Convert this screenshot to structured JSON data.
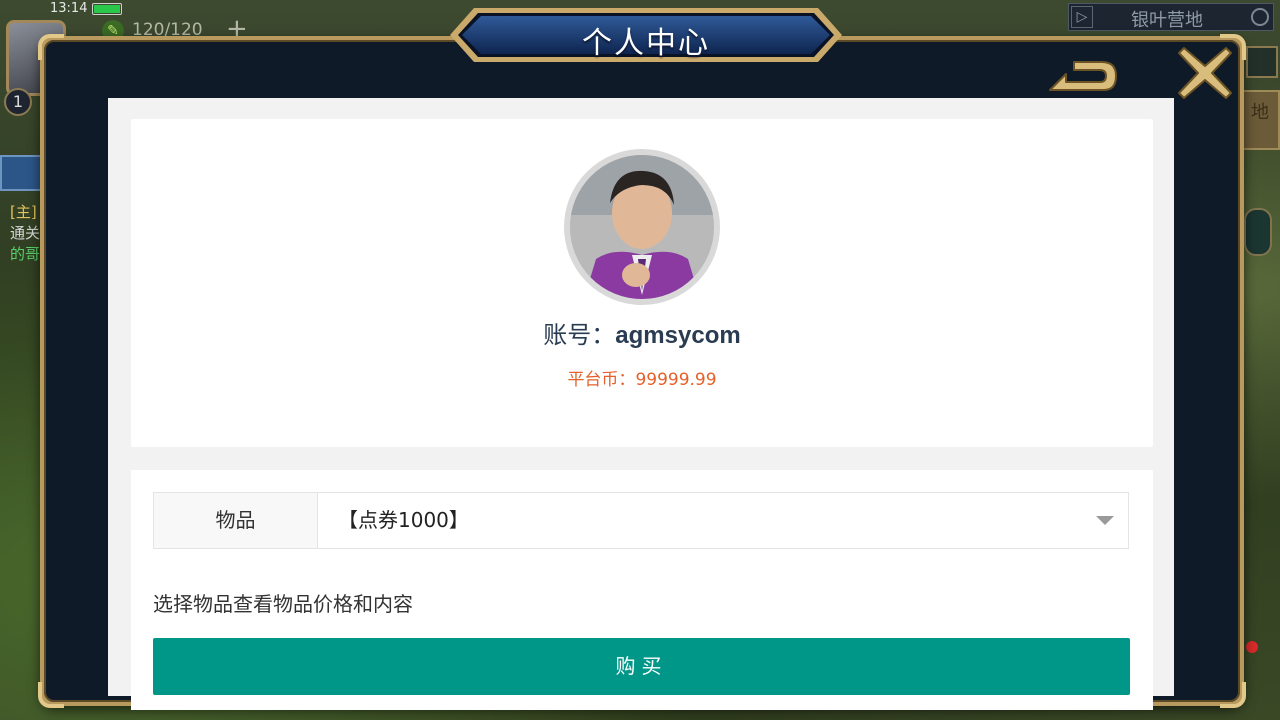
{
  "hud": {
    "time": "13:14",
    "battery_level": 1.0,
    "stamina": "120/120",
    "plus": "+",
    "level": "1",
    "location": "银叶营地",
    "quest_lines": [
      "[主]",
      "通关",
      "的哥"
    ],
    "right_panel_text": "地"
  },
  "dialog": {
    "title": "个人中心"
  },
  "profile": {
    "account_label": "账号：",
    "account_value": "agmsycom",
    "coin_label": "平台币：",
    "coin_value": "99999.99"
  },
  "shop": {
    "item_label": "物品",
    "selected_item": "【点券1000】",
    "hint": "选择物品查看物品价格和内容",
    "buy_label": "购买"
  },
  "colors": {
    "accent": "#009688",
    "coin": "#e5602a",
    "frame_gold": "#b99a5e",
    "dialog_bg": "#0f1a29"
  }
}
